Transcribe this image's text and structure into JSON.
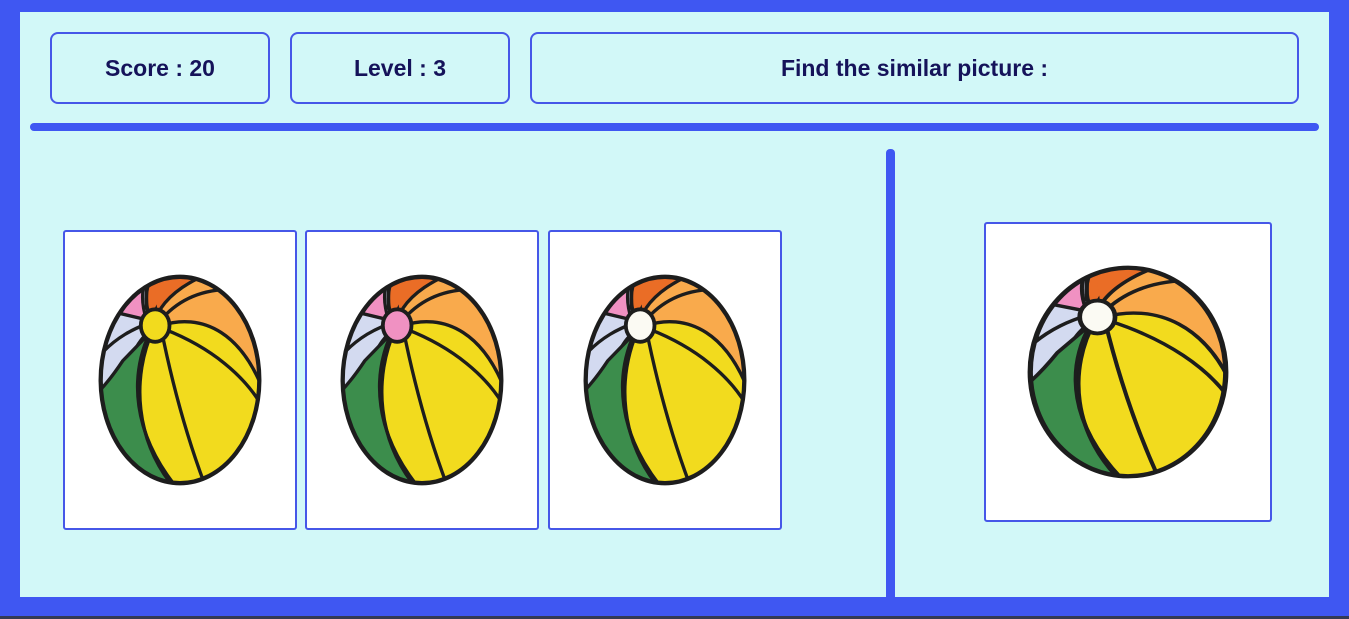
{
  "header": {
    "score_text": "Score : 20",
    "level_text": "Level : 3",
    "instruction_text": "Find the similar picture :"
  },
  "options": [
    {
      "name": "beach-ball",
      "center_color": "yellow"
    },
    {
      "name": "beach-ball",
      "center_color": "pink"
    },
    {
      "name": "beach-ball",
      "center_color": "white"
    }
  ],
  "target": {
    "name": "beach-ball",
    "center_color": "white"
  },
  "colors": {
    "frame_border": "#3f57f2",
    "panel_background": "#d2f8f8",
    "card_border": "#4657e8",
    "text": "#15135a",
    "ball_orange_dark": "#ea6d26",
    "ball_orange_light": "#f9aa4c",
    "ball_pink": "#f091c2",
    "ball_lavender": "#d3daf0",
    "ball_green": "#3c8d4c",
    "ball_yellow": "#f2db1e",
    "center_yellow": "#f2db1e",
    "center_pink": "#f091c2",
    "center_white": "#fbfaf3"
  }
}
